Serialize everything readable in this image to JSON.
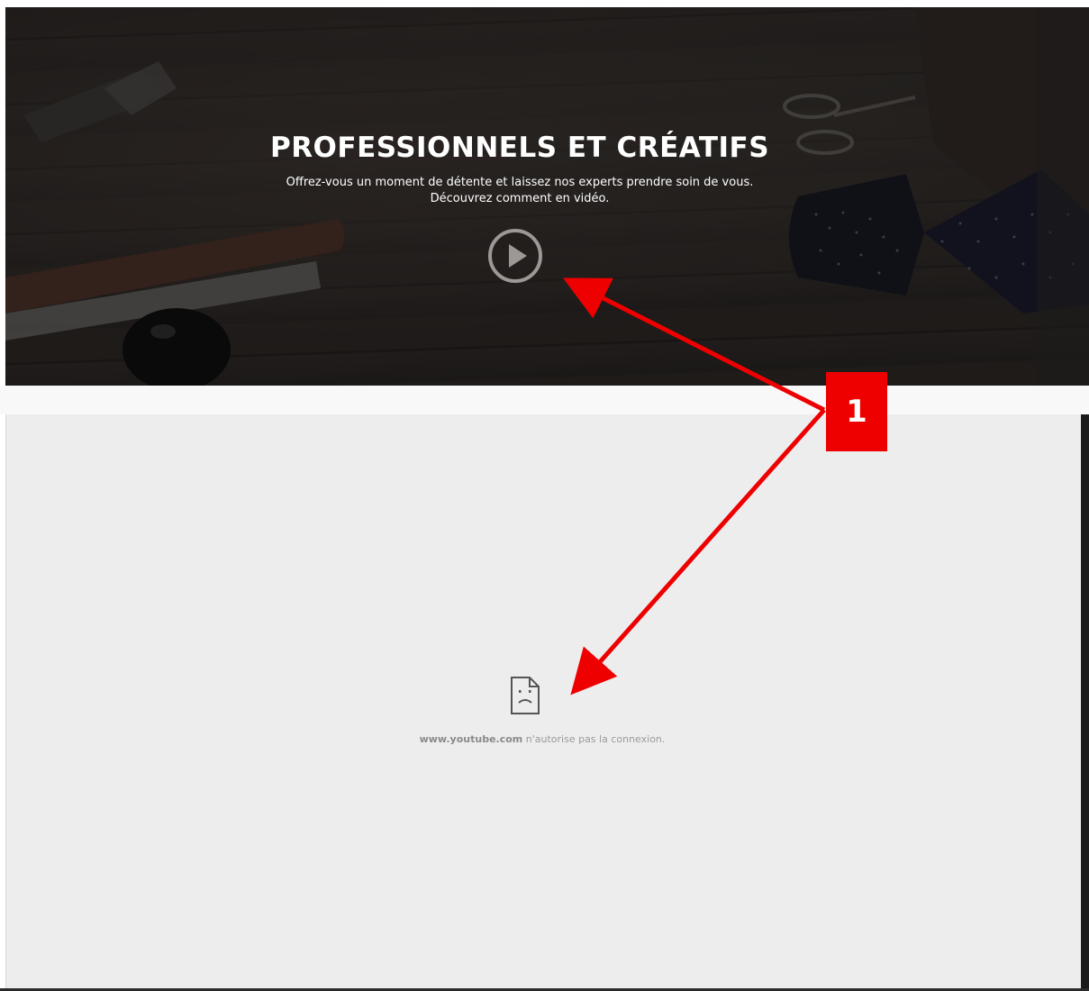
{
  "hero": {
    "title": "PROFESSIONNELS ET CRÉATIFS",
    "subtitle_line1": "Offrez-vous un moment de détente et laissez nos experts prendre soin de vous.",
    "subtitle_line2": "Découvrez comment en vidéo.",
    "play_icon": "play-circle-icon"
  },
  "embed_error": {
    "icon": "sad-file-icon",
    "domain": "www.youtube.com",
    "message": " n'autorise pas la connexion."
  },
  "annotation": {
    "badge_label": "1",
    "color": "#ee0000"
  }
}
